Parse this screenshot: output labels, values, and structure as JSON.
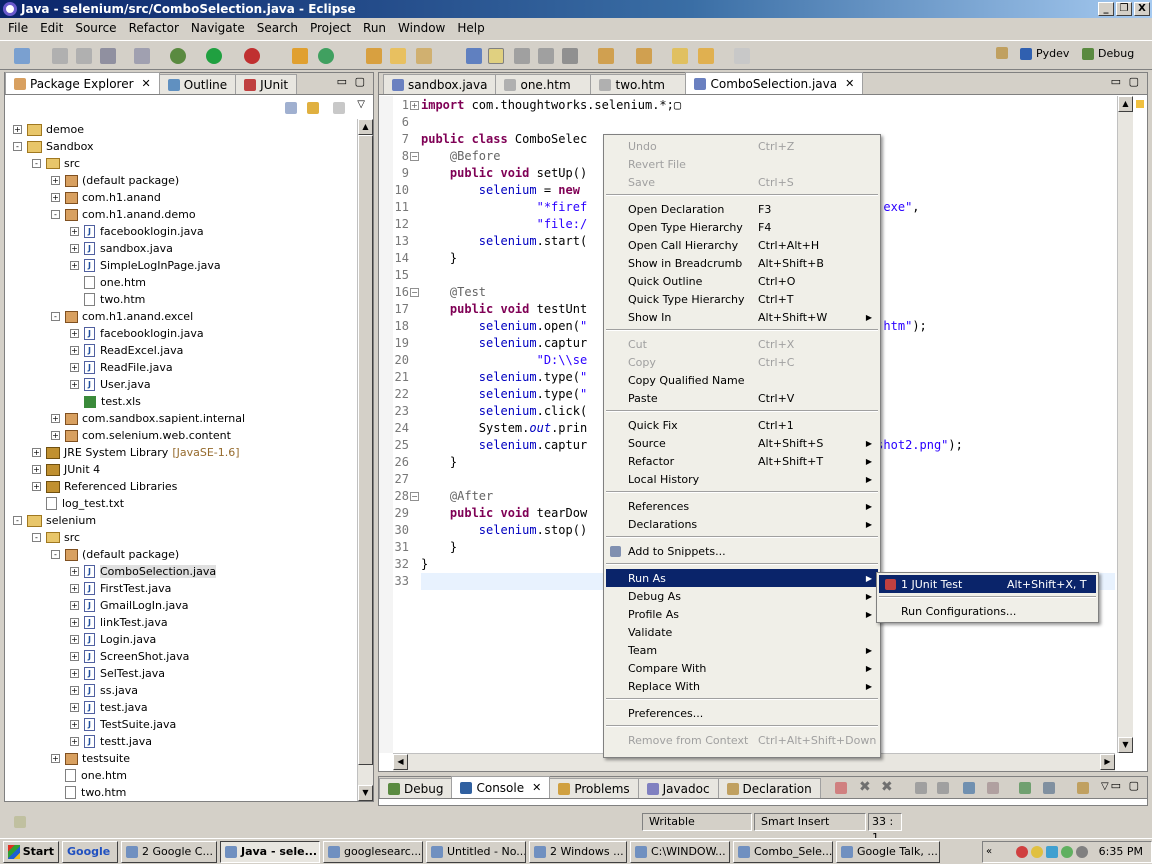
{
  "window": {
    "title": "Java - selenium/src/ComboSelection.java - Eclipse",
    "controls": [
      "_",
      "❐",
      "X"
    ]
  },
  "menu": [
    "File",
    "Edit",
    "Source",
    "Refactor",
    "Navigate",
    "Search",
    "Project",
    "Run",
    "Window",
    "Help"
  ],
  "perspectives": [
    "Pydev",
    "Debug"
  ],
  "left_tabs": [
    "Package Explorer",
    "Outline",
    "JUnit"
  ],
  "tree": [
    {
      "label": "demoe",
      "kind": "proj",
      "depth": 0,
      "tog": "+"
    },
    {
      "label": "Sandbox",
      "kind": "proj",
      "depth": 0,
      "tog": "-"
    },
    {
      "label": "src",
      "kind": "folder",
      "depth": 1,
      "tog": "-"
    },
    {
      "label": "(default package)",
      "kind": "pkg",
      "depth": 2,
      "tog": "+"
    },
    {
      "label": "com.h1.anand",
      "kind": "pkg",
      "depth": 2,
      "tog": "+"
    },
    {
      "label": "com.h1.anand.demo",
      "kind": "pkg",
      "depth": 2,
      "tog": "-"
    },
    {
      "label": "facebooklogin.java",
      "kind": "java",
      "depth": 3,
      "tog": "+"
    },
    {
      "label": "sandbox.java",
      "kind": "java",
      "depth": 3,
      "tog": "+"
    },
    {
      "label": "SimpleLogInPage.java",
      "kind": "java",
      "depth": 3,
      "tog": "+"
    },
    {
      "label": "one.htm",
      "kind": "htm",
      "depth": 3,
      "tog": ""
    },
    {
      "label": "two.htm",
      "kind": "htm",
      "depth": 3,
      "tog": ""
    },
    {
      "label": "com.h1.anand.excel",
      "kind": "pkg",
      "depth": 2,
      "tog": "-"
    },
    {
      "label": "facebooklogin.java",
      "kind": "java",
      "depth": 3,
      "tog": "+"
    },
    {
      "label": "ReadExcel.java",
      "kind": "java",
      "depth": 3,
      "tog": "+"
    },
    {
      "label": "ReadFile.java",
      "kind": "java",
      "depth": 3,
      "tog": "+"
    },
    {
      "label": "User.java",
      "kind": "java",
      "depth": 3,
      "tog": "+"
    },
    {
      "label": "test.xls",
      "kind": "xls",
      "depth": 3,
      "tog": ""
    },
    {
      "label": "com.sandbox.sapient.internal",
      "kind": "pkg",
      "depth": 2,
      "tog": "+"
    },
    {
      "label": "com.selenium.web.content",
      "kind": "pkg",
      "depth": 2,
      "tog": "+"
    },
    {
      "label": "JRE System Library",
      "suffix": "[JavaSE-1.6]",
      "kind": "lib",
      "depth": 1,
      "tog": "+"
    },
    {
      "label": "JUnit 4",
      "kind": "lib",
      "depth": 1,
      "tog": "+"
    },
    {
      "label": "Referenced Libraries",
      "kind": "lib",
      "depth": 1,
      "tog": "+"
    },
    {
      "label": "log_test.txt",
      "kind": "htm",
      "depth": 1,
      "tog": ""
    },
    {
      "label": "selenium",
      "kind": "proj",
      "depth": 0,
      "tog": "-"
    },
    {
      "label": "src",
      "kind": "folder",
      "depth": 1,
      "tog": "-"
    },
    {
      "label": "(default package)",
      "kind": "pkg",
      "depth": 2,
      "tog": "-"
    },
    {
      "label": "ComboSelection.java",
      "kind": "java",
      "depth": 3,
      "tog": "+",
      "selected": true
    },
    {
      "label": "FirstTest.java",
      "kind": "java",
      "depth": 3,
      "tog": "+"
    },
    {
      "label": "GmailLogIn.java",
      "kind": "java",
      "depth": 3,
      "tog": "+"
    },
    {
      "label": "linkTest.java",
      "kind": "java",
      "depth": 3,
      "tog": "+"
    },
    {
      "label": "Login.java",
      "kind": "java",
      "depth": 3,
      "tog": "+"
    },
    {
      "label": "ScreenShot.java",
      "kind": "java",
      "depth": 3,
      "tog": "+"
    },
    {
      "label": "SelTest.java",
      "kind": "java",
      "depth": 3,
      "tog": "+"
    },
    {
      "label": "ss.java",
      "kind": "java",
      "depth": 3,
      "tog": "+"
    },
    {
      "label": "test.java",
      "kind": "java",
      "depth": 3,
      "tog": "+"
    },
    {
      "label": "TestSuite.java",
      "kind": "java",
      "depth": 3,
      "tog": "+"
    },
    {
      "label": "testt.java",
      "kind": "java",
      "depth": 3,
      "tog": "+"
    },
    {
      "label": "testsuite",
      "kind": "pkg",
      "depth": 2,
      "tog": "+"
    },
    {
      "label": "one.htm",
      "kind": "htm",
      "depth": 2,
      "tog": ""
    },
    {
      "label": "two.htm",
      "kind": "htm",
      "depth": 2,
      "tog": ""
    }
  ],
  "editor_tabs": [
    {
      "label": "sandbox.java",
      "active": false
    },
    {
      "label": "one.htm",
      "active": false
    },
    {
      "label": "two.htm",
      "active": false
    },
    {
      "label": "ComboSelection.java",
      "active": true
    }
  ],
  "code": [
    {
      "n": "1",
      "fold": "+",
      "html": "<span class='kw'>import</span> com.thoughtworks.selenium.*;▢"
    },
    {
      "n": "6",
      "html": ""
    },
    {
      "n": "7",
      "html": "<span class='kw'>public class</span> ComboSelec"
    },
    {
      "n": "8",
      "fold": "-",
      "html": "    <span class='ann'>@Before</span>"
    },
    {
      "n": "9",
      "html": "    <span class='kw'>public void</span> setUp()"
    },
    {
      "n": "10",
      "html": "        <span class='fld'>selenium</span> = <span class='kw'>new</span>                             "
    },
    {
      "n": "11",
      "html": "                <span class='str'>\"*firef</span>                            <span class='str'>fox\\\\firefox.exe\"</span>,"
    },
    {
      "n": "12",
      "html": "                <span class='str'>\"file:/</span>                            <span class='str'>rc/one.htm\"</span>);"
    },
    {
      "n": "13",
      "html": "        <span class='fld'>selenium</span>.start("
    },
    {
      "n": "14",
      "html": "    }"
    },
    {
      "n": "15",
      "html": ""
    },
    {
      "n": "16",
      "fold": "-",
      "html": "    <span class='ann'>@Test</span>"
    },
    {
      "n": "17",
      "html": "    <span class='kw'>public void</span> testUnt"
    },
    {
      "n": "18",
      "html": "        <span class='fld'>selenium</span>.open(<span class='str'>\"</span>                            <span class='str'>nium/src/one.htm\"</span>);"
    },
    {
      "n": "19",
      "html": "        <span class='fld'>selenium</span>.captur"
    },
    {
      "n": "20",
      "html": "                <span class='str'>\"D:\\\\se</span>                            <span class='str'>ng\"</span>, <span class='str'>\"\"</span>);"
    },
    {
      "n": "21",
      "html": "        <span class='fld'>selenium</span>.type(<span class='str'>\"</span>"
    },
    {
      "n": "22",
      "html": "        <span class='fld'>selenium</span>.type(<span class='str'>\"</span>"
    },
    {
      "n": "23",
      "html": "        <span class='fld'>selenium</span>.click("
    },
    {
      "n": "24",
      "html": "        System.<span class='fld it'>out</span>.prin"
    },
    {
      "n": "25",
      "html": "        <span class='fld'>selenium</span>.captur                            <span class='str'>hots\\\\screenshot2.png\"</span>);"
    },
    {
      "n": "26",
      "html": "    }"
    },
    {
      "n": "27",
      "html": ""
    },
    {
      "n": "28",
      "fold": "-",
      "html": "    <span class='ann'>@After</span>"
    },
    {
      "n": "29",
      "html": "    <span class='kw'>public void</span> tearDow"
    },
    {
      "n": "30",
      "html": "        <span class='fld'>selenium</span>.stop()"
    },
    {
      "n": "31",
      "html": "    }"
    },
    {
      "n": "32",
      "html": "}"
    },
    {
      "n": "33",
      "html": ""
    }
  ],
  "context_menu": [
    {
      "label": "Undo",
      "shortcut": "Ctrl+Z",
      "disabled": true
    },
    {
      "label": "Revert File",
      "disabled": true
    },
    {
      "label": "Save",
      "shortcut": "Ctrl+S",
      "disabled": true
    },
    {
      "sep": true
    },
    {
      "label": "Open Declaration",
      "shortcut": "F3"
    },
    {
      "label": "Open Type Hierarchy",
      "shortcut": "F4"
    },
    {
      "label": "Open Call Hierarchy",
      "shortcut": "Ctrl+Alt+H"
    },
    {
      "label": "Show in Breadcrumb",
      "shortcut": "Alt+Shift+B"
    },
    {
      "label": "Quick Outline",
      "shortcut": "Ctrl+O"
    },
    {
      "label": "Quick Type Hierarchy",
      "shortcut": "Ctrl+T"
    },
    {
      "label": "Show In",
      "shortcut": "Alt+Shift+W",
      "sub": true
    },
    {
      "sep": true
    },
    {
      "label": "Cut",
      "shortcut": "Ctrl+X",
      "disabled": true
    },
    {
      "label": "Copy",
      "shortcut": "Ctrl+C",
      "disabled": true
    },
    {
      "label": "Copy Qualified Name"
    },
    {
      "label": "Paste",
      "shortcut": "Ctrl+V"
    },
    {
      "sep": true
    },
    {
      "label": "Quick Fix",
      "shortcut": "Ctrl+1"
    },
    {
      "label": "Source",
      "shortcut": "Alt+Shift+S",
      "sub": true
    },
    {
      "label": "Refactor",
      "shortcut": "Alt+Shift+T",
      "sub": true
    },
    {
      "label": "Local History",
      "sub": true
    },
    {
      "sep": true
    },
    {
      "label": "References",
      "sub": true
    },
    {
      "label": "Declarations",
      "sub": true
    },
    {
      "sep": true
    },
    {
      "label": "Add to Snippets...",
      "icon": true
    },
    {
      "sep": true
    },
    {
      "label": "Run As",
      "sub": true,
      "highlight": true
    },
    {
      "label": "Debug As",
      "sub": true
    },
    {
      "label": "Profile As",
      "sub": true
    },
    {
      "label": "Validate"
    },
    {
      "label": "Team",
      "sub": true
    },
    {
      "label": "Compare With",
      "sub": true
    },
    {
      "label": "Replace With",
      "sub": true
    },
    {
      "sep": true
    },
    {
      "label": "Preferences..."
    },
    {
      "sep": true
    },
    {
      "label": "Remove from Context",
      "shortcut": "Ctrl+Alt+Shift+Down",
      "disabled": true
    }
  ],
  "submenu": [
    {
      "label": "1 JUnit Test",
      "shortcut": "Alt+Shift+X, T",
      "highlight": true
    },
    {
      "sep": true
    },
    {
      "label": "Run Configurations..."
    }
  ],
  "bottom_tabs": [
    {
      "label": "Debug",
      "active": false
    },
    {
      "label": "Console",
      "active": true
    },
    {
      "label": "Problems",
      "active": false
    },
    {
      "label": "Javadoc",
      "active": false
    },
    {
      "label": "Declaration",
      "active": false
    }
  ],
  "status": {
    "writable": "Writable",
    "mode": "Smart Insert",
    "position": "33 : 1"
  },
  "taskbar": {
    "start": "Start",
    "search": "Google",
    "tasks": [
      {
        "label": "2 Google C...",
        "w": 96
      },
      {
        "label": "Java - sele...",
        "w": 100,
        "active": true
      },
      {
        "label": "googlesearc...",
        "w": 100
      },
      {
        "label": "Untitled - No...",
        "w": 100
      },
      {
        "label": "2 Windows ...",
        "w": 98
      },
      {
        "label": "C:\\WINDOW...",
        "w": 100
      },
      {
        "label": "Combo_Sele...",
        "w": 100
      },
      {
        "label": "Google Talk, ...",
        "w": 104
      }
    ],
    "clock": "6:35 PM"
  }
}
